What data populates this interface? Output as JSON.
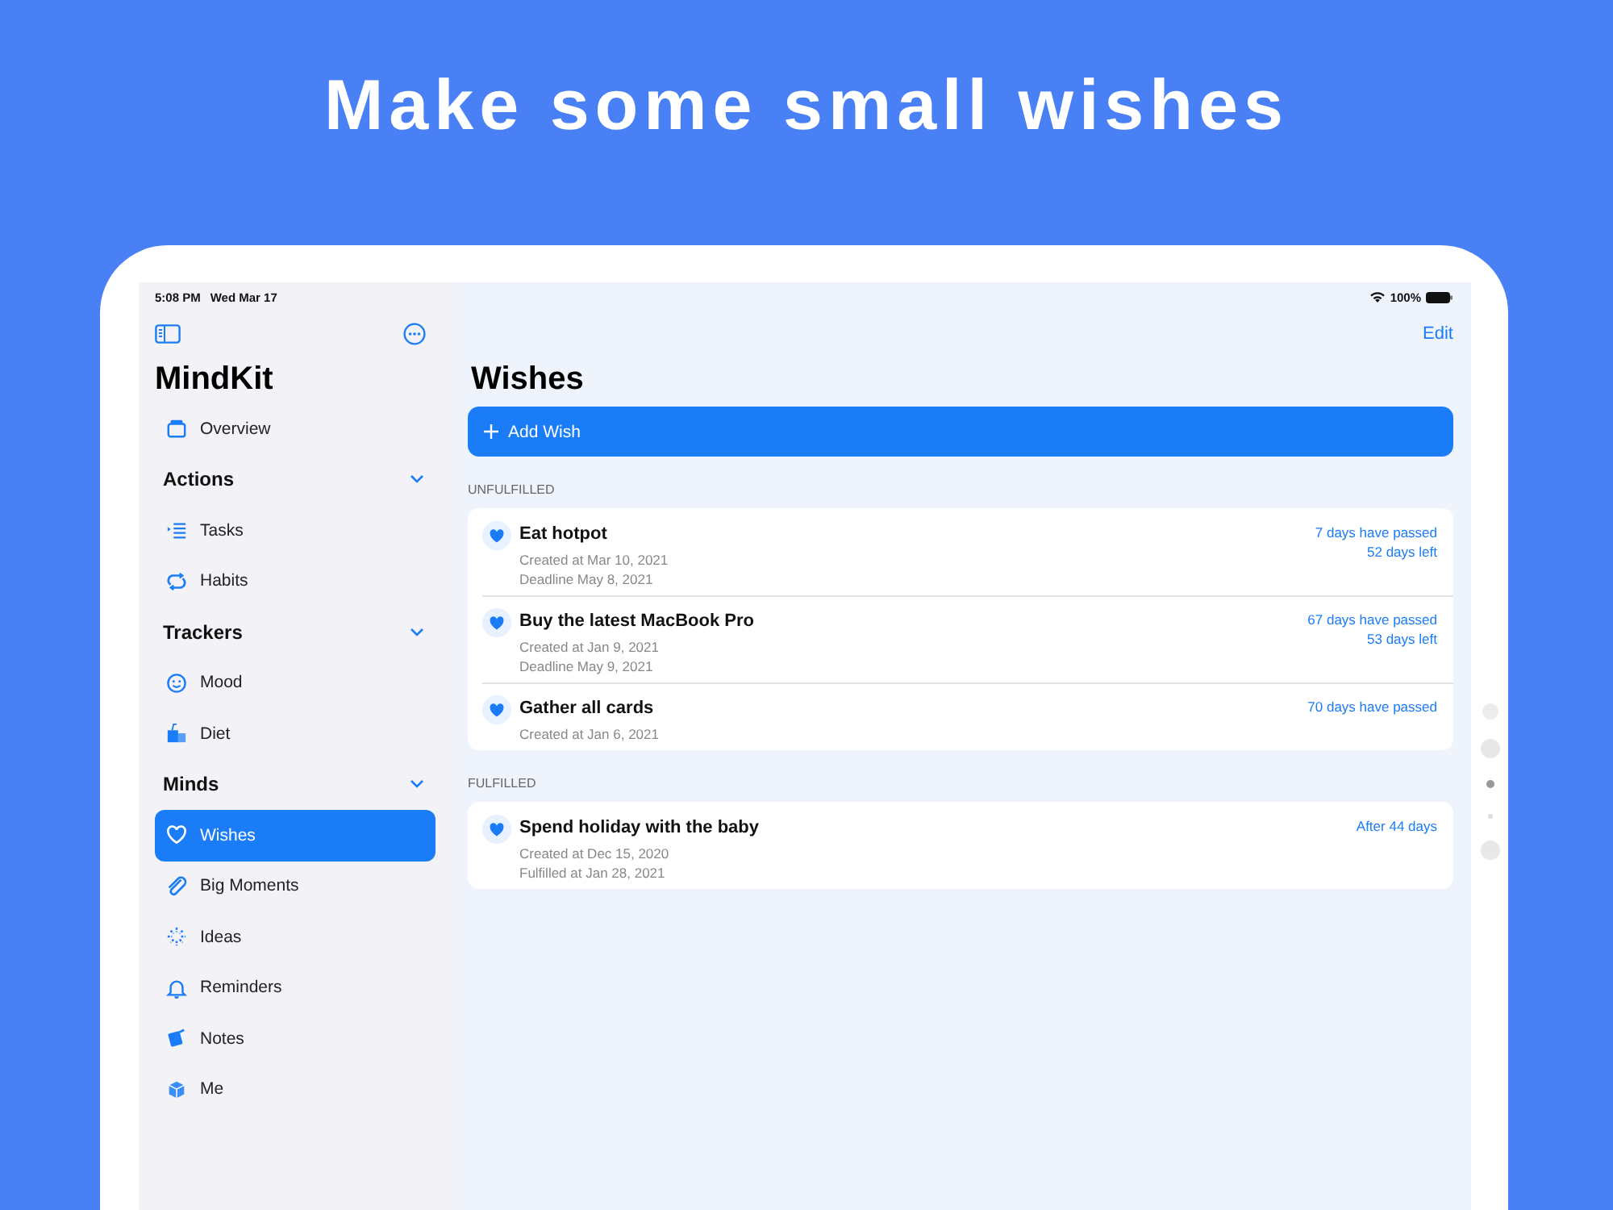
{
  "headline": "Make some small wishes",
  "status_bar": {
    "time": "5:08 PM",
    "date": "Wed Mar 17",
    "battery": "100%"
  },
  "sidebar": {
    "title": "MindKit",
    "items": [
      {
        "label": "Overview",
        "selected": false
      }
    ],
    "sections": [
      {
        "title": "Actions",
        "expanded": true,
        "items": [
          {
            "label": "Tasks",
            "selected": false
          },
          {
            "label": "Habits",
            "selected": false
          }
        ]
      },
      {
        "title": "Trackers",
        "expanded": true,
        "items": [
          {
            "label": "Mood",
            "selected": false
          },
          {
            "label": "Diet",
            "selected": false
          }
        ]
      },
      {
        "title": "Minds",
        "expanded": true,
        "items": [
          {
            "label": "Wishes",
            "selected": true
          },
          {
            "label": "Big Moments",
            "selected": false
          },
          {
            "label": "Ideas",
            "selected": false
          },
          {
            "label": "Reminders",
            "selected": false
          },
          {
            "label": "Notes",
            "selected": false
          },
          {
            "label": "Me",
            "selected": false
          }
        ]
      }
    ]
  },
  "main": {
    "edit": "Edit",
    "title": "Wishes",
    "add_button": "Add Wish",
    "groups": [
      {
        "header": "UNFULFILLED",
        "wishes": [
          {
            "title": "Eat hotpot",
            "details": [
              "Created at Mar 10, 2021",
              "Deadline May 8, 2021"
            ],
            "status": [
              "7 days have passed",
              "52 days left"
            ]
          },
          {
            "title": "Buy the latest MacBook Pro",
            "details": [
              "Created at Jan 9, 2021",
              "Deadline May 9, 2021"
            ],
            "status": [
              "67 days have passed",
              "53 days left"
            ]
          },
          {
            "title": "Gather all cards",
            "details": [
              "Created at Jan 6, 2021"
            ],
            "status": [
              "70 days have passed"
            ]
          }
        ]
      },
      {
        "header": "FULFILLED",
        "wishes": [
          {
            "title": "Spend holiday with the baby",
            "details": [
              "Created at Dec 15, 2020",
              "Fulfilled at Jan 28, 2021"
            ],
            "status": [
              "After 44 days"
            ]
          }
        ]
      }
    ]
  }
}
